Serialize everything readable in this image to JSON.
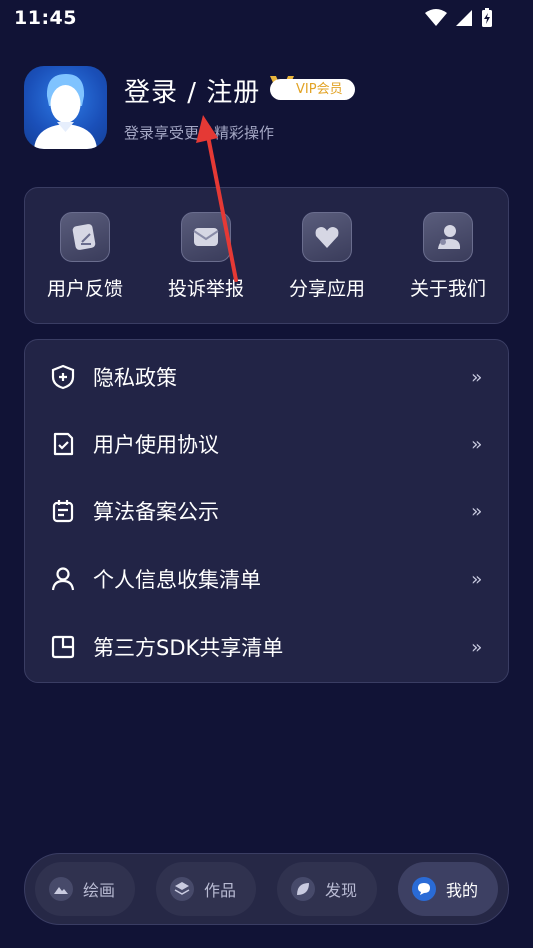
{
  "status_bar": {
    "time": "11:45"
  },
  "profile": {
    "title": "登录 / 注册",
    "vip_badge": "VIP会员",
    "subtitle": "登录享受更多精彩操作"
  },
  "quick_actions": [
    {
      "label": "用户反馈",
      "icon": "feedback-icon"
    },
    {
      "label": "投诉举报",
      "icon": "mail-icon"
    },
    {
      "label": "分享应用",
      "icon": "share-heart-icon"
    },
    {
      "label": "关于我们",
      "icon": "about-users-icon"
    }
  ],
  "menu": [
    {
      "label": "隐私政策",
      "icon": "shield-plus-icon",
      "chevron": "»"
    },
    {
      "label": "用户使用协议",
      "icon": "document-check-icon",
      "chevron": "»"
    },
    {
      "label": "算法备案公示",
      "icon": "calendar-list-icon",
      "chevron": "»"
    },
    {
      "label": "个人信息收集清单",
      "icon": "person-icon",
      "chevron": "»"
    },
    {
      "label": "第三方SDK共享清单",
      "icon": "pie-document-icon",
      "chevron": "»"
    }
  ],
  "bottom_nav": [
    {
      "label": "绘画",
      "icon": "painting-icon",
      "active": false
    },
    {
      "label": "作品",
      "icon": "layers-icon",
      "active": false
    },
    {
      "label": "发现",
      "icon": "leaf-icon",
      "active": false
    },
    {
      "label": "我的",
      "icon": "chat-bubble-icon",
      "active": true
    }
  ],
  "colors": {
    "background": "#111336",
    "card": "#222446",
    "vip_gold": "#e2a325",
    "annotation_arrow": "#e53935",
    "active_nav_icon": "#2a6bd6"
  }
}
